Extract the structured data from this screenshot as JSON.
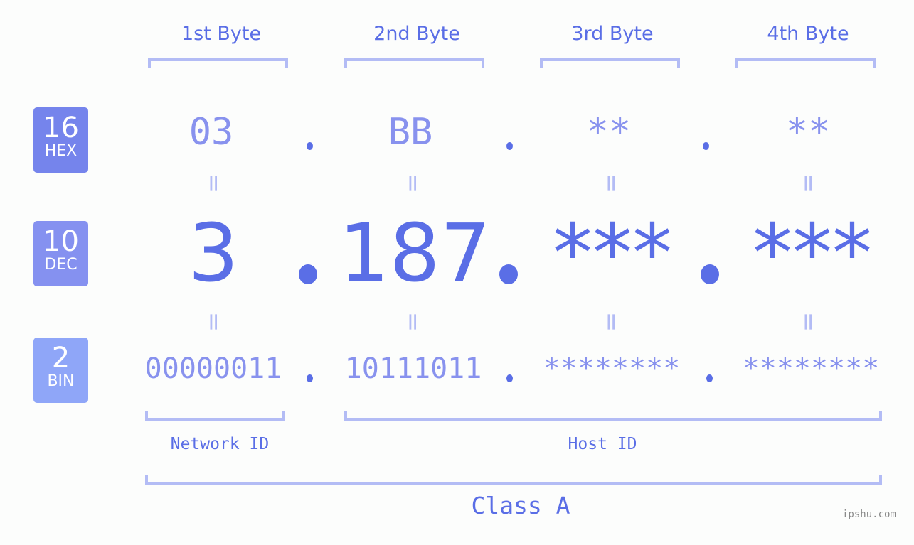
{
  "bytes": [
    {
      "label": "1st Byte",
      "hex": "03",
      "dec": "3",
      "bin": "00000011"
    },
    {
      "label": "2nd Byte",
      "hex": "BB",
      "dec": "187",
      "bin": "10111011"
    },
    {
      "label": "3rd Byte",
      "hex": "**",
      "dec": "***",
      "bin": "********"
    },
    {
      "label": "4th Byte",
      "hex": "**",
      "dec": "***",
      "bin": "********"
    }
  ],
  "badges": {
    "hex": {
      "num": "16",
      "label": "HEX",
      "color": "#7584ec"
    },
    "dec": {
      "num": "10",
      "label": "DEC",
      "color": "#8591f0"
    },
    "bin": {
      "num": "2",
      "label": "BIN",
      "color": "#8fa6f8"
    }
  },
  "equals_glyph": "=",
  "network_id_label": "Network ID",
  "host_id_label": "Host ID",
  "class_label": "Class A",
  "watermark": "ipshu.com",
  "colors": {
    "primary": "#5a6ee6",
    "secondary": "#8892ee",
    "bracket": "#b3bcf5"
  }
}
